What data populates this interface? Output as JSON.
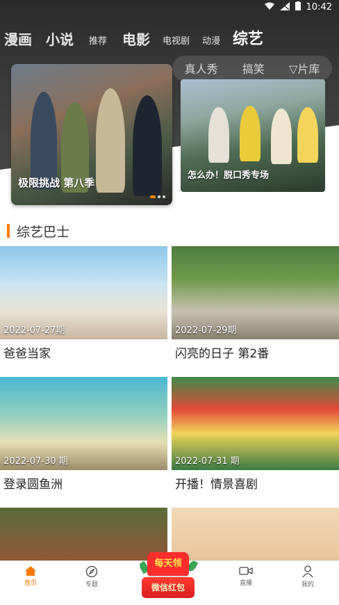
{
  "status_bar": {
    "time": "10:42"
  },
  "top_tabs": [
    {
      "label": "漫画",
      "size": "lg"
    },
    {
      "label": "小说",
      "size": "lg"
    },
    {
      "label": "推荐",
      "size": "sm"
    },
    {
      "label": "电影",
      "size": "lg"
    },
    {
      "label": "电视剧",
      "size": "sm"
    },
    {
      "label": "动漫",
      "size": "sm"
    },
    {
      "label": "综艺",
      "size": "active"
    }
  ],
  "sub_tabs": [
    "真人秀",
    "搞笑",
    "▽片库"
  ],
  "banner": {
    "main_title": "极限挑战 第八季",
    "side_title": "怎么办！脱口秀专场"
  },
  "section_title": "综艺巴士",
  "items": [
    {
      "date": "2022-07-27期",
      "title": "爸爸当家"
    },
    {
      "date": "2022-07-29期",
      "title": "闪亮的日子 第2番"
    },
    {
      "date": "2022-07-30 期",
      "title": "登录圆鱼洲"
    },
    {
      "date": "2022-07-31 期",
      "title": "开播！情景喜剧"
    },
    {
      "date": "",
      "title": ""
    },
    {
      "date": "",
      "title": ""
    }
  ],
  "bottom_nav": [
    {
      "label": "首页",
      "icon": "home-icon",
      "active": true
    },
    {
      "label": "专题",
      "icon": "compass-icon",
      "active": false
    },
    {
      "label": "直播",
      "icon": "video-camera-icon",
      "active": false
    },
    {
      "label": "我的",
      "icon": "person-icon",
      "active": false
    }
  ],
  "red_packet": {
    "top": "每天领",
    "bottom": "微信红包"
  },
  "colors": {
    "accent": "#ff7a00",
    "hero_bg": "#333333",
    "red_packet": "#ff2d2d"
  }
}
